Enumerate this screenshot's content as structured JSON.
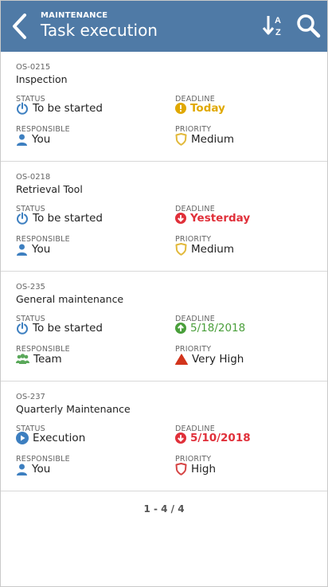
{
  "header": {
    "supertitle": "MAINTENANCE",
    "title": "Task execution",
    "background_color": "#4f7aa6"
  },
  "labels": {
    "status": "STATUS",
    "deadline": "DEADLINE",
    "responsible": "RESPONSIBLE",
    "priority": "PRIORITY"
  },
  "tasks": [
    {
      "code": "OS-0215",
      "name": "Inspection",
      "status": "To be started",
      "status_icon": "power-icon",
      "deadline": "Today",
      "deadline_icon": "warning-circle-icon",
      "responsible": "You",
      "responsible_icon": "person-icon",
      "priority": "Medium",
      "priority_icon": "shield-icon"
    },
    {
      "code": "OS-0218",
      "name": "Retrieval Tool",
      "status": "To be started",
      "status_icon": "power-icon",
      "deadline": "Yesterday",
      "deadline_icon": "arrow-down-circle-icon",
      "responsible": "You",
      "responsible_icon": "person-icon",
      "priority": "Medium",
      "priority_icon": "shield-icon"
    },
    {
      "code": "OS-235",
      "name": "General maintenance",
      "status": "To be started",
      "status_icon": "power-icon",
      "deadline": "5/18/2018",
      "deadline_icon": "arrow-up-circle-icon",
      "responsible": "Team",
      "responsible_icon": "team-icon",
      "priority": "Very High",
      "priority_icon": "triangle-icon"
    },
    {
      "code": "OS-237",
      "name": "Quarterly Maintenance",
      "status": "Execution",
      "status_icon": "play-circle-icon",
      "deadline": "5/10/2018",
      "deadline_icon": "arrow-down-circle-icon",
      "responsible": "You",
      "responsible_icon": "person-icon",
      "priority": "High",
      "priority_icon": "shield-icon"
    }
  ],
  "pagination": "1 - 4 / 4",
  "colors": {
    "accent_blue": "#3d7fc0",
    "warning_yellow": "#e0a800",
    "overdue_red": "#e0303a",
    "ok_green": "#4a9f3b",
    "team_green": "#5aa85a",
    "medium_priority": "#e2b93b",
    "very_high_priority": "#d2341c",
    "high_priority": "#d64545"
  }
}
